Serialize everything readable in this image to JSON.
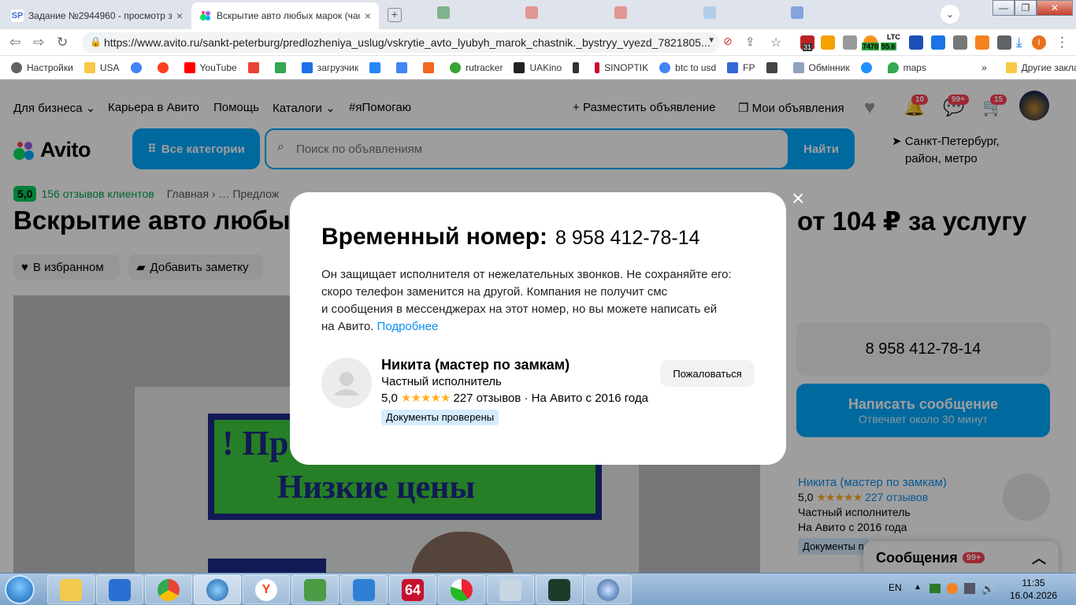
{
  "browser": {
    "tabs": [
      {
        "favicon_text": "SP",
        "title": "Задание №2944960 - просмотр з"
      },
      {
        "title": "Вскрытие авто любых марок (час"
      }
    ],
    "url": "https://www.avito.ru/sankt-peterburg/predlozheniya_uslug/vskrytie_avto_lyubyh_marok_chastnik._bystryy_vyezd_7821805...",
    "ext_badges": {
      "ext31": "31",
      "ltc_label": "LTC",
      "ltc_left": "7470",
      "ltc_right": "55.6"
    },
    "bookmarks": [
      "Настройки",
      "USA",
      "",
      "",
      "YouTube",
      "",
      "",
      "загрузчик",
      "",
      "",
      "",
      "rutracker",
      "UAKino",
      "",
      "SINOPTIK",
      "btc to usd",
      "FP",
      "",
      "Обмінник",
      "",
      "maps"
    ],
    "bookmarks_more": "»",
    "bookmarks_other": "Другие закладки"
  },
  "site": {
    "top_nav": {
      "business": "Для бизнеса",
      "career": "Карьера в Авито",
      "help": "Помощь",
      "catalogs": "Каталоги",
      "help_tag": "#яПомогаю",
      "post_ad": "Разместить объявление",
      "my_ads": "Мои объявления",
      "badge_messages": "10",
      "badge_notifications": "99+",
      "badge_cart": "15"
    },
    "logo": "Avito",
    "all_categories": "Все категории",
    "search_placeholder": "Поиск по объявлениям",
    "search_button": "Найти",
    "location_line1": "Санкт-Петербург,",
    "location_line2": "район, метро",
    "rating": "5,0",
    "reviews_link": "156 отзывов клиентов",
    "breadcrumb": "Главная › … Предлож",
    "title_fragment": "Вскрытие авто любых",
    "price": "от 104 ₽ за услугу",
    "favorite_button": "В избранном",
    "note_button": "Добавить заметку",
    "photo_sign_top": "! Пр",
    "photo_sign_bottom": "Низкие цены",
    "side_phone": "8 958 412-78-14",
    "write_message": "Написать сообщение",
    "response_time": "Отвечает около 30 минут",
    "seller_name": "Никита (мастер по замкам)",
    "seller_rating": "5,0",
    "seller_reviews": "227 отзывов",
    "seller_type": "Частный исполнитель",
    "seller_since": "На Авито с 2016 года",
    "docs_badge_cut": "Документы п",
    "messages_bar": "Сообщения",
    "messages_count": "99+"
  },
  "modal": {
    "title": "Временный номер:",
    "phone": "8 958 412-78-14",
    "desc_line1": "Он защищает исполнителя от нежелательных звонков. Не сохраняйте его:",
    "desc_line2": "скоро телефон заменится на другой. Компания не получит смс",
    "desc_line3": "и сообщения в мессенджерах на этот номер, но вы можете написать ей",
    "desc_line4_prefix": "на Авито.",
    "more_link": "Подробнее",
    "seller_name": "Никита (мастер по замкам)",
    "seller_type": "Частный исполнитель",
    "rating": "5,0",
    "reviews": "227 отзывов",
    "since": " · На Авито с 2016 года",
    "docs_verified": "Документы проверены",
    "complain": "Пожаловаться",
    "close_glyph": "×"
  },
  "taskbar": {
    "lang": "EN",
    "app_64": "64",
    "time": "11:35",
    "date": "16.04.2026"
  },
  "colors": {
    "avito_blue": "#00aaff",
    "link": "#0a8ef0",
    "star": "#ffb021",
    "badge_red": "#ff4053",
    "rating_green": "#02d15c"
  }
}
